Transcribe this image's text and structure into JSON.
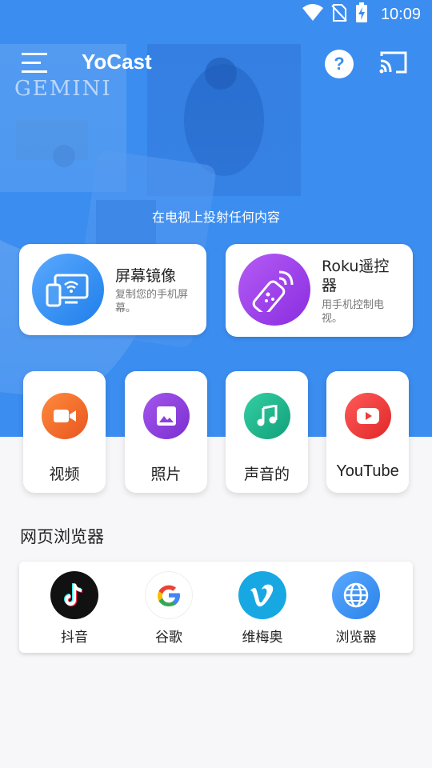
{
  "status_bar": {
    "time": "10:09",
    "icons": [
      "wifi-icon",
      "no-sim-icon",
      "battery-charging-icon"
    ]
  },
  "app_bar": {
    "title": "YoCast",
    "help_label": "?",
    "icons": [
      "menu-icon",
      "help-icon",
      "cast-icon"
    ]
  },
  "hero": {
    "background_color": "#3b8df0",
    "poster_text": "GEMINI",
    "tagline": "在电视上投射任何内容"
  },
  "features": [
    {
      "title": "屏幕镜像",
      "subtitle": "复制您的手机屏幕。",
      "icon": "screen-mirror-icon",
      "color": "#2f8ff5"
    },
    {
      "title": "Roku遥控器",
      "subtitle": "用手机控制电视。",
      "icon": "remote-control-icon",
      "color": "#9b3eeb"
    }
  ],
  "categories": [
    {
      "label": "视频",
      "icon": "video-camera-icon",
      "color": "#f26a2e"
    },
    {
      "label": "照片",
      "icon": "image-icon",
      "color": "#8e3fd9"
    },
    {
      "label": "声音的",
      "icon": "music-note-icon",
      "color": "#1fb58e"
    },
    {
      "label": "YouTube",
      "icon": "youtube-icon",
      "color": "#ef3a3a"
    }
  ],
  "web_section": {
    "title": "网页浏览器",
    "items": [
      {
        "label": "抖音",
        "icon": "tiktok-icon"
      },
      {
        "label": "谷歌",
        "icon": "google-icon"
      },
      {
        "label": "维梅奥",
        "icon": "vimeo-icon"
      },
      {
        "label": "浏览器",
        "icon": "globe-icon"
      }
    ]
  }
}
